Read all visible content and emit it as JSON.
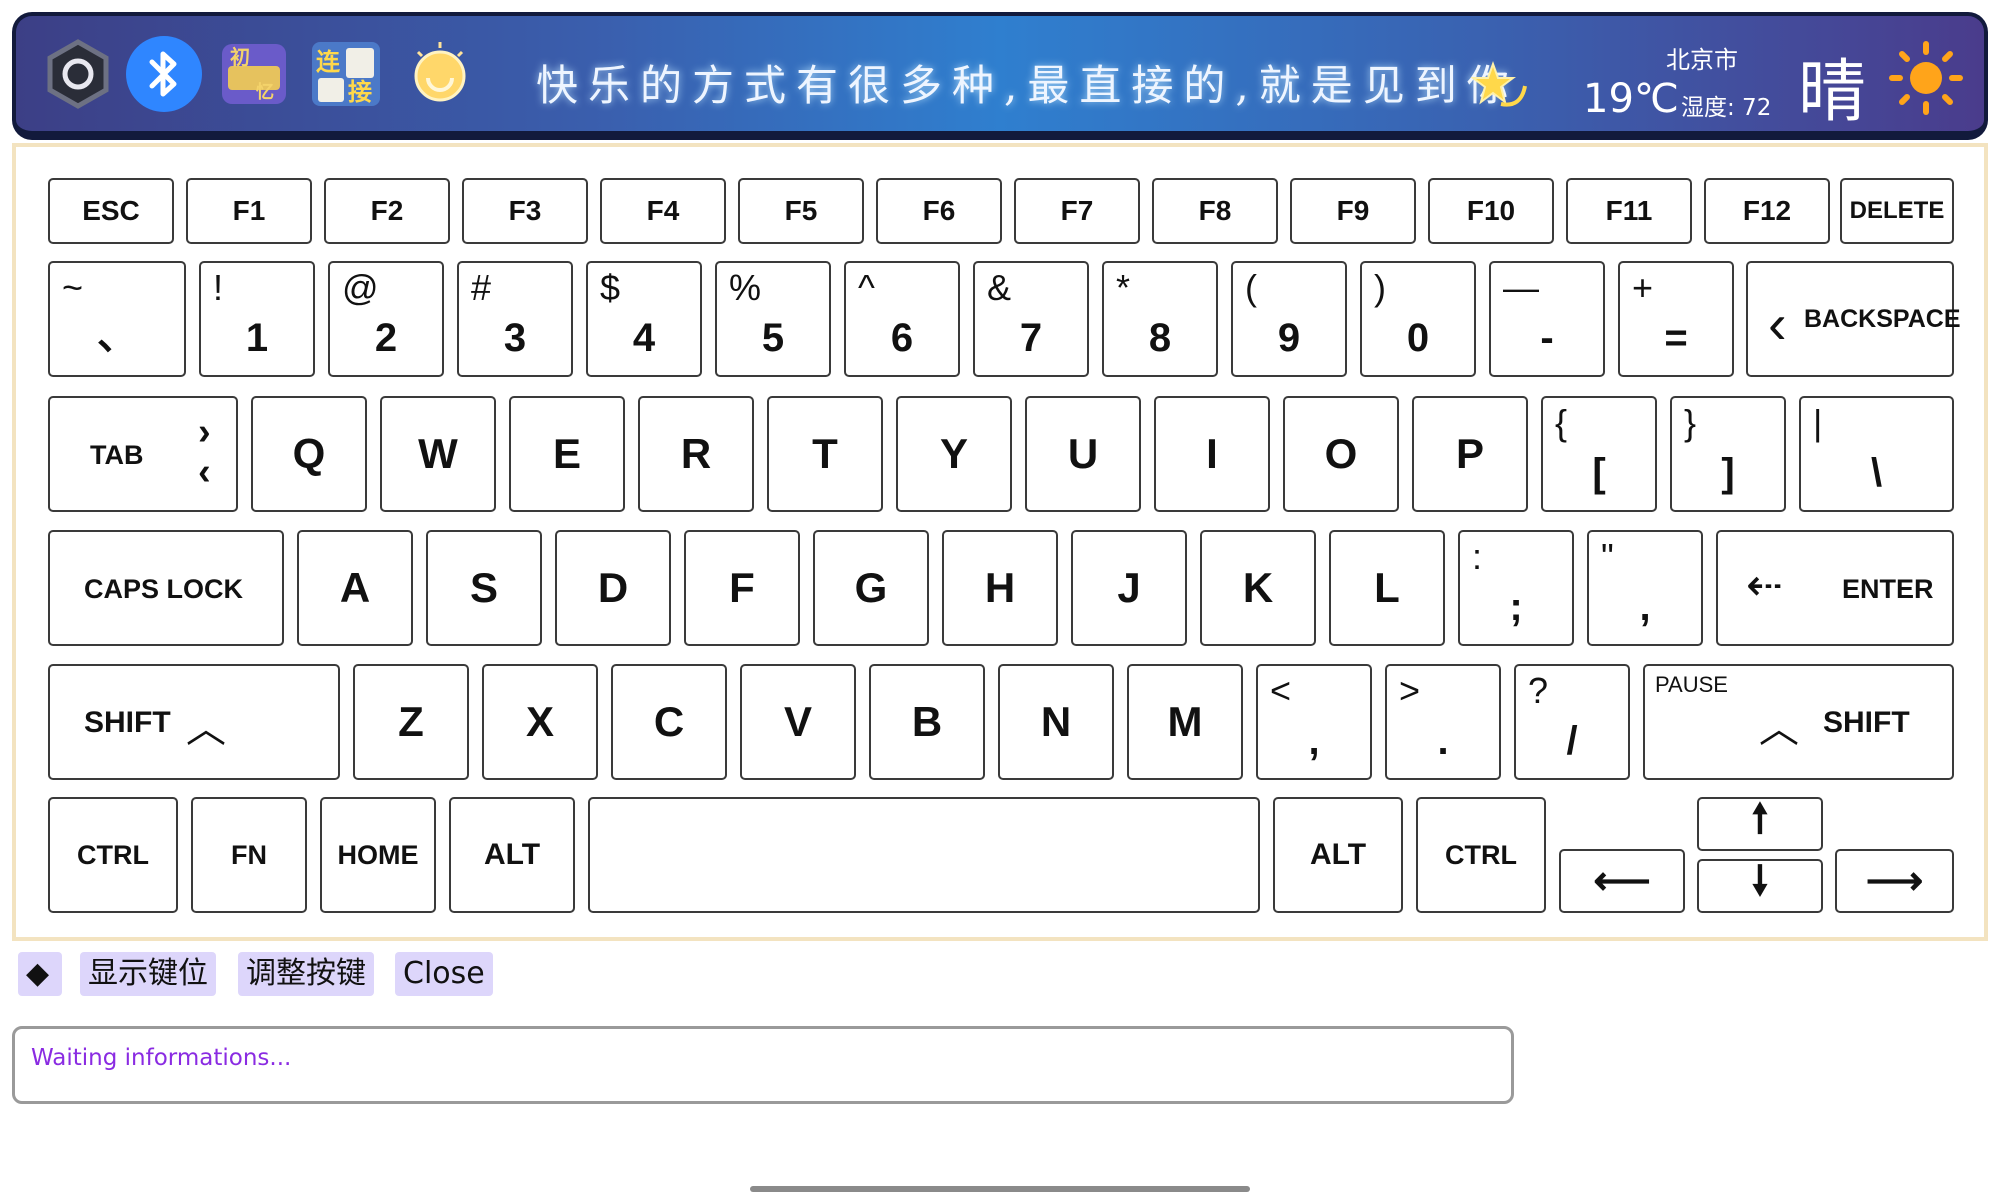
{
  "header": {
    "motto": "快乐的方式有很多种,最直接的,就是见到你",
    "weather": {
      "city": "北京市",
      "temperature": "19℃",
      "humidity": "湿度: 72",
      "condition": "晴",
      "icon": "sun-icon"
    },
    "icons": [
      "hexagon-app-icon",
      "bluetooth-icon",
      "chuxinji-sticker-icon",
      "lianjie-sticker-icon",
      "lightbulb-icon"
    ]
  },
  "keyboard": {
    "function_row": [
      "ESC",
      "F1",
      "F2",
      "F3",
      "F4",
      "F5",
      "F6",
      "F7",
      "F8",
      "F9",
      "F10",
      "F11",
      "F12",
      "DELETE"
    ],
    "number_row": [
      {
        "shift": "~",
        "main": "、"
      },
      {
        "shift": "!",
        "main": "1"
      },
      {
        "shift": "@",
        "main": "2"
      },
      {
        "shift": "#",
        "main": "3"
      },
      {
        "shift": "$",
        "main": "4"
      },
      {
        "shift": "%",
        "main": "5"
      },
      {
        "shift": "^",
        "main": "6"
      },
      {
        "shift": "&",
        "main": "7"
      },
      {
        "shift": "*",
        "main": "8"
      },
      {
        "shift": "(",
        "main": "9"
      },
      {
        "shift": ")",
        "main": "0"
      },
      {
        "shift": "—",
        "main": "-"
      },
      {
        "shift": "+",
        "main": "="
      }
    ],
    "backspace": "BACKSPACE",
    "tab": "TAB",
    "qwerty_row": [
      "Q",
      "W",
      "E",
      "R",
      "T",
      "Y",
      "U",
      "I",
      "O",
      "P"
    ],
    "bracket_keys": [
      {
        "shift": "{",
        "main": "["
      },
      {
        "shift": "}",
        "main": "]"
      },
      {
        "shift": "|",
        "main": "\\"
      }
    ],
    "caps_lock": "CAPS LOCK",
    "home_row": [
      "A",
      "S",
      "D",
      "F",
      "G",
      "H",
      "J",
      "K",
      "L"
    ],
    "home_row_punct": [
      {
        "shift": ":",
        "main": ";"
      },
      {
        "shift": "\"",
        "main": ","
      }
    ],
    "enter": "ENTER",
    "shift_left": "SHIFT",
    "bottom_letters": [
      "Z",
      "X",
      "C",
      "V",
      "B",
      "N",
      "M"
    ],
    "bottom_punct": [
      {
        "shift": "<",
        "main": ","
      },
      {
        "shift": ">",
        "main": "."
      },
      {
        "shift": "?",
        "main": "/"
      }
    ],
    "pause": "PAUSE",
    "shift_right": "SHIFT",
    "modifier_row": [
      "CTRL",
      "FN",
      "HOME",
      "ALT"
    ],
    "modifier_row_right": [
      "ALT",
      "CTRL"
    ]
  },
  "controls": {
    "toggle_symbol": "◆",
    "show_keys": "显示键位",
    "adjust_keys": "调整按键",
    "close": "Close"
  },
  "info": {
    "status": "Waiting informations..."
  }
}
